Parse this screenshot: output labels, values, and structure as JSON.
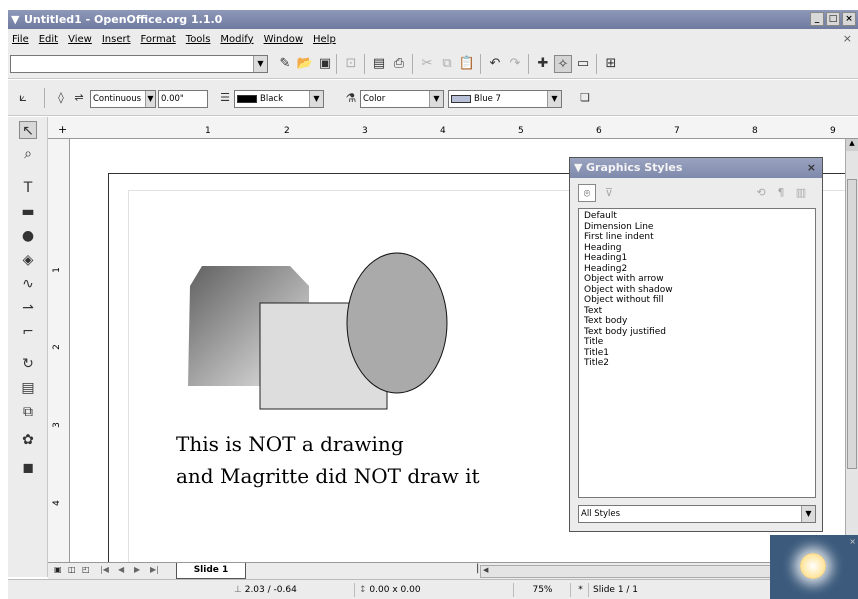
{
  "window": {
    "title": "Untitled1 - OpenOffice.org 1.1.0"
  },
  "menubar": {
    "items": [
      "File",
      "Edit",
      "View",
      "Insert",
      "Format",
      "Tools",
      "Modify",
      "Window",
      "Help"
    ],
    "close_glyph": "×"
  },
  "toolbar1": {
    "url_value": "",
    "icons": [
      "edit-file-icon",
      "open-icon",
      "save-icon",
      "export-pdf-icon",
      "print-preview-icon",
      "print-icon",
      "cut-icon",
      "copy-icon",
      "paste-icon",
      "undo-icon",
      "redo-icon",
      "crosshair-icon",
      "navigator-icon",
      "gallery-icon",
      "datasource-icon"
    ]
  },
  "toolbar2": {
    "line_style": "Continuous",
    "line_width": "0.00\"",
    "line_color": "Black",
    "area_style": "Color",
    "area_color": "Blue 7",
    "colors": {
      "line_color": "#000000",
      "area_color": "#b8c0d8"
    }
  },
  "ruler": {
    "h_ticks": [
      "1",
      "2",
      "3",
      "4",
      "5",
      "6",
      "7",
      "8",
      "9"
    ],
    "v_ticks": [
      "1",
      "2",
      "3",
      "4"
    ]
  },
  "document": {
    "line1": "This is NOT a drawing",
    "line2": "and Magritte did NOT draw it"
  },
  "stylist": {
    "title": "Graphics Styles",
    "items": [
      "Default",
      "Dimension Line",
      "First line indent",
      "Heading",
      "Heading1",
      "Heading2",
      "Object with arrow",
      "Object with shadow",
      "Object without fill",
      "Text",
      "Text body",
      "Text body justified",
      "Title",
      "Title1",
      "Title2"
    ],
    "filter_value": "All Styles"
  },
  "tabbar": {
    "active_tab": "Slide 1"
  },
  "statusbar": {
    "position": "2.03 / -0.64",
    "size": "0.00 x 0.00",
    "zoom": "75%",
    "modified": "*",
    "page": "Slide 1 / 1"
  }
}
